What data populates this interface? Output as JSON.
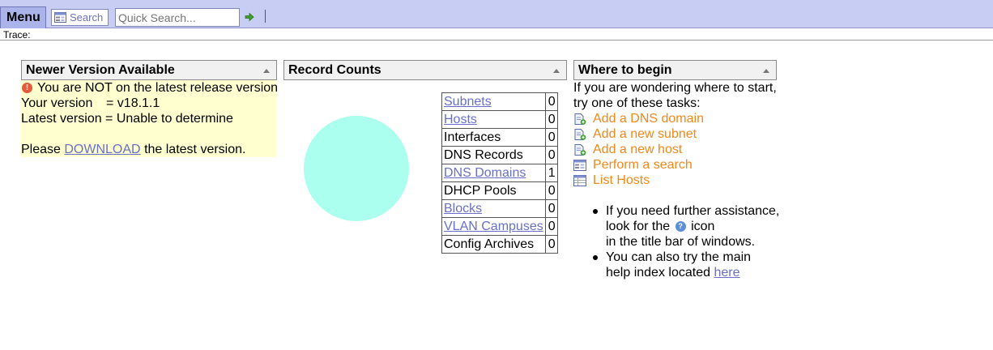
{
  "topbar": {
    "menu_label": "Menu",
    "search_label": "Search",
    "quick_search": {
      "placeholder": "Quick Search..."
    }
  },
  "trace": {
    "label": "Trace:"
  },
  "newer_version": {
    "title": "Newer Version Available",
    "warning": "You are NOT on the latest release version",
    "your_version_label": "Your version",
    "your_version_value": "= v18.1.1",
    "latest_version": "Latest version = Unable to determine",
    "please": "Please",
    "download_link": "DOWNLOAD",
    "the_latest": "the latest version."
  },
  "record_counts": {
    "title": "Record Counts",
    "rows": [
      {
        "label": "Subnets",
        "value": "0",
        "link": true
      },
      {
        "label": "Hosts",
        "value": "0",
        "link": true
      },
      {
        "label": "Interfaces",
        "value": "0",
        "link": false
      },
      {
        "label": "DNS Records",
        "value": "0",
        "link": false
      },
      {
        "label": "DNS Domains",
        "value": "1",
        "link": true
      },
      {
        "label": "DHCP Pools",
        "value": "0",
        "link": false
      },
      {
        "label": "Blocks",
        "value": "0",
        "link": true
      },
      {
        "label": "VLAN Campuses",
        "value": "0",
        "link": true
      },
      {
        "label": "Config Archives",
        "value": "0",
        "link": false
      }
    ],
    "pie_color": "#aaffee"
  },
  "where_to_begin": {
    "title": "Where to begin",
    "intro_line1": "If you are wondering where to start,",
    "intro_line2": "try one of these tasks:",
    "tasks": [
      {
        "label": "Add a DNS domain",
        "icon": "add-page-icon"
      },
      {
        "label": "Add a new subnet",
        "icon": "add-page-icon"
      },
      {
        "label": "Add a new host",
        "icon": "add-page-icon"
      },
      {
        "label": "Perform a search",
        "icon": "search-form-icon"
      },
      {
        "label": "List Hosts",
        "icon": "list-table-icon"
      }
    ],
    "tip1_line1": "If you need further assistance,",
    "tip1_line2a": "look for the",
    "tip1_line2b": "icon",
    "tip1_line3": "in the title bar of windows.",
    "tip2_line1": "You can also try the main",
    "tip2_line2": "help index located",
    "tip2_link": "here"
  },
  "colors": {
    "topbar": "#c8cdf3",
    "link": "#6870c7",
    "task_link": "#f0881a",
    "notice_bg": "#ffffd0"
  }
}
